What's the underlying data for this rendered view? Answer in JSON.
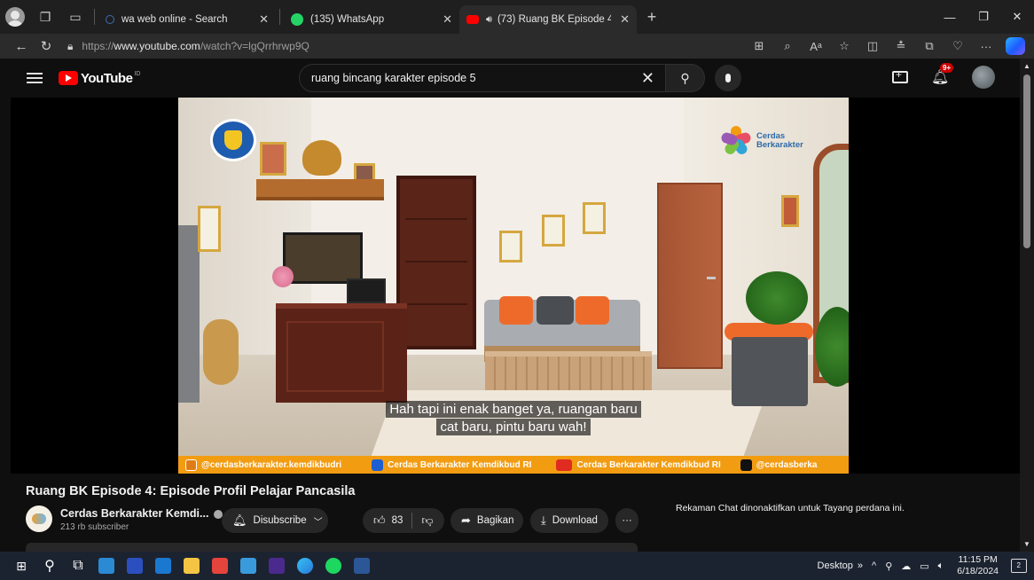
{
  "browser": {
    "tabs": [
      {
        "title": "wa web online - Search",
        "active": false
      },
      {
        "title": "(135) WhatsApp",
        "active": false
      },
      {
        "title": "(73) Ruang BK Episode 4: Ep",
        "active": true
      }
    ],
    "url_prefix": "https://",
    "url_domain": "www.youtube.com",
    "url_path": "/watch?v=lgQrrhrwp9Q"
  },
  "youtube": {
    "logo_text": "YouTube",
    "country_code": "ID",
    "search_value": "ruang bincang karakter episode 5",
    "notification_badge": "9+"
  },
  "video": {
    "subtitle_line1": "Hah tapi ini enak banget ya, ruangan baru",
    "subtitle_line2": "cat baru, pintu baru wah!",
    "brand_line1": "Cerdas",
    "brand_line2": "Berkarakter",
    "ticker": [
      {
        "label": "@cerdasberkarakter.kemdikbudri",
        "color": "#e07b16"
      },
      {
        "label": "Cerdas Berkarakter Kemdikbud RI",
        "color": "#1d5fd0"
      },
      {
        "label": "Cerdas Berkarakter Kemdikbud RI",
        "color": "#e02b20"
      },
      {
        "label": "@cerdasberka",
        "color": "#111111"
      }
    ],
    "title": "Ruang BK Episode 4: Episode Profil Pelajar Pancasila",
    "channel_name": "Cerdas Berkarakter Kemdi...",
    "subscribers": "213 rb subscriber",
    "subscribe_label": "Disubscribe",
    "like_count": "83",
    "share_label": "Bagikan",
    "download_label": "Download",
    "chat_note": "Rekaman Chat dinonaktifkan untuk Tayang perdana ini."
  },
  "taskbar": {
    "desktop_label": "Desktop",
    "time": "11:15 PM",
    "date": "6/18/2024",
    "notif_count": "2"
  },
  "colors": {
    "yt_red": "#ff0000",
    "ticker_orange": "#f29c12",
    "accent_orange": "#ee6a2b"
  }
}
